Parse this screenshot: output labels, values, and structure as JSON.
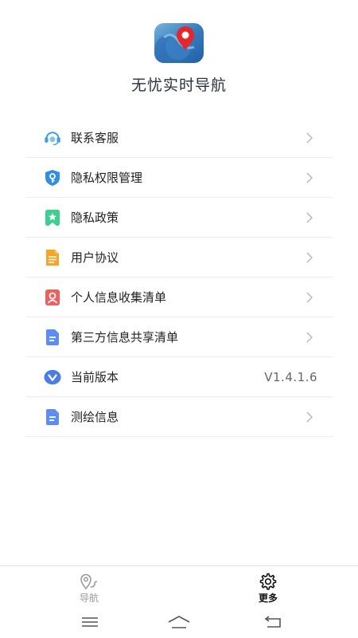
{
  "app": {
    "title": "无忧实时导航",
    "logo_icon": "app-logo-map-pin"
  },
  "menu": {
    "items": [
      {
        "label": "联系客服",
        "icon": "headset-icon",
        "color": "#3fa0e8",
        "chevron": true
      },
      {
        "label": "隐私权限管理",
        "icon": "shield-key-icon",
        "color": "#2f8fe8",
        "chevron": true
      },
      {
        "label": "隐私政策",
        "icon": "bookmark-star-icon",
        "color": "#3ccf8e",
        "chevron": true
      },
      {
        "label": "用户协议",
        "icon": "document-icon",
        "color": "#f5a623",
        "chevron": true
      },
      {
        "label": "个人信息收集清单",
        "icon": "user-card-icon",
        "color": "#f0605a",
        "chevron": true
      },
      {
        "label": "第三方信息共享清单",
        "icon": "list-doc-icon",
        "color": "#5b8ef0",
        "chevron": true
      },
      {
        "label": "当前版本",
        "icon": "version-v-icon",
        "color": "#4a7de8",
        "value": "V1.4.1.6",
        "chevron": false
      },
      {
        "label": "测绘信息",
        "icon": "list-doc-icon",
        "color": "#5b8ef0",
        "chevron": true
      }
    ]
  },
  "tabbar": {
    "tabs": [
      {
        "label": "导航",
        "icon": "map-pin-route-icon",
        "active": false
      },
      {
        "label": "更多",
        "icon": "gear-icon",
        "active": true
      }
    ]
  },
  "system_nav": {
    "buttons": [
      "menu-icon",
      "home-icon",
      "back-icon"
    ]
  }
}
